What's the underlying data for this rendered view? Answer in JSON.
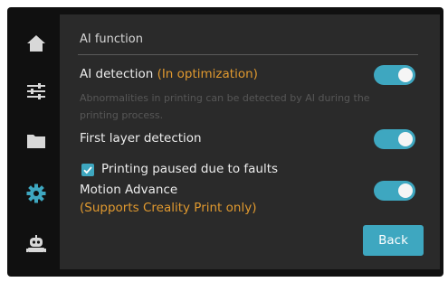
{
  "sidebar": {
    "items": [
      {
        "name": "home",
        "icon": "home-icon",
        "active": false
      },
      {
        "name": "settings-tune",
        "icon": "sliders-icon",
        "active": false
      },
      {
        "name": "files",
        "icon": "folder-icon",
        "active": false
      },
      {
        "name": "settings",
        "icon": "gear-icon",
        "active": true
      },
      {
        "name": "ai-assistant",
        "icon": "robot-icon",
        "active": false
      }
    ],
    "icon_color": "#d8d8d8",
    "active_color": "#3ea7c0"
  },
  "panel": {
    "title": "AI function",
    "ai_detection": {
      "label": "AI detection",
      "status": "(In optimization)",
      "description": "Abnormalities in printing can be detected by AI during the printing process.",
      "enabled": true
    },
    "first_layer": {
      "label": "First layer detection",
      "enabled": true,
      "pause_checkbox": {
        "label": "Printing paused due to faults",
        "checked": true
      }
    },
    "motion_advance": {
      "label": "Motion Advance",
      "note": "(Supports Creality Print only)",
      "enabled": true
    },
    "back_label": "Back"
  },
  "colors": {
    "accent": "#3ea7c0",
    "warning": "#e0992f",
    "panel_bg": "#2a2a2a",
    "bezel": "#101010"
  }
}
